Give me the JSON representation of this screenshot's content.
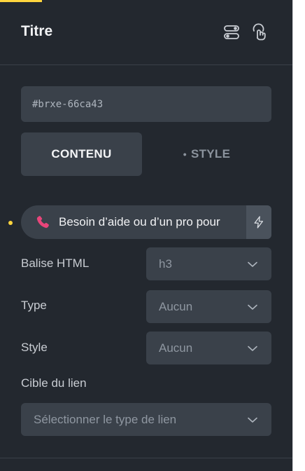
{
  "panel": {
    "title": "Titre",
    "header_icons": [
      "toggle-switch-icon",
      "pointer-hand-icon"
    ]
  },
  "element_id": "#brxe-66ca43",
  "tabs": {
    "content": "CONTENU",
    "style": "STYLE",
    "style_dot": "•"
  },
  "text_field": {
    "icon": "phone-icon",
    "value": "Besoin d’aide ou d’un pro pour",
    "dynamic_icon": "lightning-icon"
  },
  "controls": {
    "html_tag_label": "Balise HTML",
    "html_tag_value": "h3",
    "type_label": "Type",
    "type_value": "Aucun",
    "style_label": "Style",
    "style_value": "Aucun",
    "link_target_label": "Cible du lien",
    "link_target_placeholder": "Sélectionner le type de lien"
  },
  "colors": {
    "panel_bg": "#23282f",
    "field_bg": "#3a414a",
    "accent": "#ffd53e",
    "phone_icon": "#e8457a"
  }
}
